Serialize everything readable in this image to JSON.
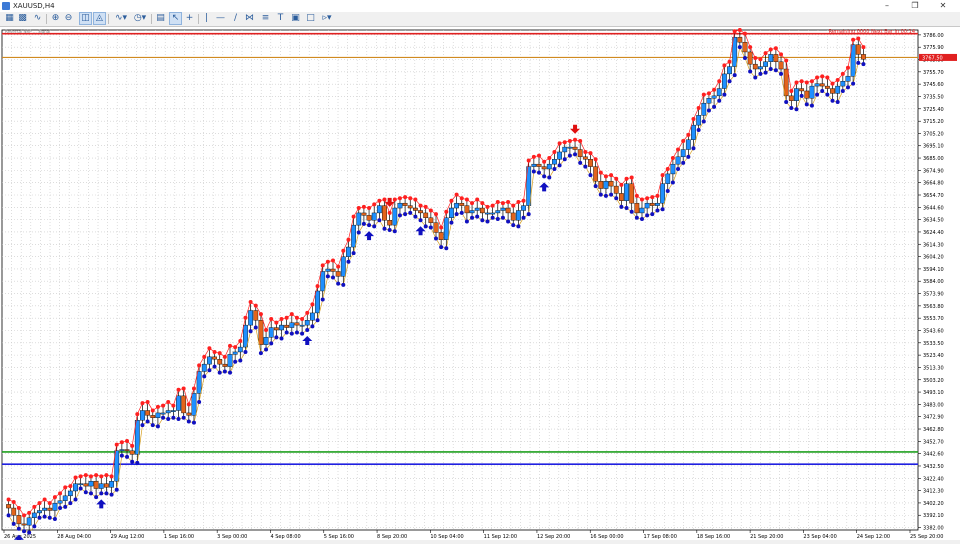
{
  "window": {
    "title": "XAUUSD,H4"
  },
  "toolbar": {
    "icons": [
      "new-chart-icon",
      "arrange-windows-icon",
      "indicators-icon",
      "zoom-in-icon",
      "zoom-out-icon",
      "tile-windows-icon",
      "scroll-chart-icon",
      "chart-type-icon",
      "periods-icon",
      "templates-icon",
      "cursor-icon",
      "crosshair-icon",
      "vertical-line-icon",
      "horizontal-line-icon",
      "trendline-icon",
      "channel-icon",
      "text-icon",
      "label-icon",
      "shapes-icon"
    ]
  },
  "indicator_label": "Reversal NRP ... Signal",
  "timer_text": "Remaining 0000  Next Bar in 00:14",
  "colors": {
    "bull_candle": "#1e90ff",
    "bear_candle": "#e3641c",
    "high_dot": "#ff2020",
    "low_dot": "#1010c0",
    "buy_arrow": "#1010c0",
    "sell_arrow": "#e01010",
    "resistance_line": "#e02020",
    "price_line": "#d08a20",
    "support_green": "#20a020",
    "support_blue": "#2020e0",
    "grid": "#c8c8c8"
  },
  "chart_data": {
    "type": "candlestick",
    "symbol": "XAUUSD",
    "timeframe": "H4",
    "ylim": [
      3380,
      3790
    ],
    "y_ticks": [
      "3786.00",
      "3775.90",
      "3765.80",
      "3755.70",
      "3745.60",
      "3735.50",
      "3725.40",
      "3715.20",
      "3705.20",
      "3695.10",
      "3685.00",
      "3674.90",
      "3664.80",
      "3654.70",
      "3644.60",
      "3634.50",
      "3624.40",
      "3614.30",
      "3604.20",
      "3594.10",
      "3584.00",
      "3573.90",
      "3563.80",
      "3553.70",
      "3543.60",
      "3533.50",
      "3523.40",
      "3513.30",
      "3503.20",
      "3493.10",
      "3483.00",
      "3472.90",
      "3462.80",
      "3452.70",
      "3442.60",
      "3432.50",
      "3422.40",
      "3412.30",
      "3402.20",
      "3392.10",
      "3382.00"
    ],
    "x_labels": [
      "26 Aug 2025",
      "28 Aug 04:00",
      "29 Aug 12:00",
      "1 Sep 16:00",
      "3 Sep 00:00",
      "4 Sep 08:00",
      "5 Sep 16:00",
      "8 Sep 20:00",
      "10 Sep 04:00",
      "11 Sep 12:00",
      "12 Sep 20:00",
      "16 Sep 00:00",
      "17 Sep 08:00",
      "18 Sep 16:00",
      "21 Sep 20:00",
      "23 Sep 04:00",
      "24 Sep 12:00",
      "25 Sep 20:00"
    ],
    "current_price": "3767.50",
    "levels": {
      "resistance": 3787,
      "price_line": 3767.5,
      "support_green": 3444,
      "support_blue": 3434
    },
    "closes": [
      3398,
      3392,
      3385,
      3384,
      3390,
      3394,
      3396,
      3398,
      3396,
      3402,
      3404,
      3408,
      3412,
      3418,
      3418,
      3416,
      3420,
      3414,
      3418,
      3415,
      3420,
      3445,
      3446,
      3445,
      3442,
      3470,
      3478,
      3474,
      3472,
      3476,
      3476,
      3478,
      3478,
      3490,
      3476,
      3474,
      3492,
      3510,
      3516,
      3522,
      3520,
      3516,
      3514,
      3524,
      3526,
      3530,
      3548,
      3560,
      3552,
      3532,
      3538,
      3546,
      3544,
      3548,
      3546,
      3550,
      3548,
      3548,
      3552,
      3558,
      3576,
      3592,
      3594,
      3592,
      3588,
      3604,
      3612,
      3630,
      3640,
      3638,
      3634,
      3640,
      3646,
      3634,
      3630,
      3644,
      3648,
      3646,
      3644,
      3642,
      3640,
      3636,
      3632,
      3624,
      3618,
      3636,
      3644,
      3648,
      3646,
      3640,
      3642,
      3644,
      3640,
      3640,
      3640,
      3642,
      3644,
      3640,
      3634,
      3642,
      3646,
      3678,
      3680,
      3678,
      3676,
      3680,
      3684,
      3690,
      3694,
      3694,
      3692,
      3686,
      3684,
      3678,
      3666,
      3660,
      3666,
      3662,
      3656,
      3650,
      3664,
      3648,
      3640,
      3644,
      3648,
      3646,
      3648,
      3664,
      3672,
      3680,
      3686,
      3692,
      3700,
      3712,
      3720,
      3730,
      3734,
      3736,
      3742,
      3754,
      3760,
      3784,
      3780,
      3772,
      3762,
      3758,
      3760,
      3764,
      3770,
      3764,
      3758,
      3736,
      3732,
      3742,
      3740,
      3734,
      3744,
      3746,
      3744,
      3742,
      3738,
      3744,
      3748,
      3752,
      3778,
      3770,
      3766
    ],
    "signals": [
      {
        "type": "buy",
        "index": 2
      },
      {
        "type": "buy",
        "index": 18
      },
      {
        "type": "buy",
        "index": 58
      },
      {
        "type": "sell",
        "index": 74
      },
      {
        "type": "buy",
        "index": 70
      },
      {
        "type": "buy",
        "index": 80
      },
      {
        "type": "buy",
        "index": 104
      },
      {
        "type": "sell",
        "index": 110
      }
    ]
  }
}
